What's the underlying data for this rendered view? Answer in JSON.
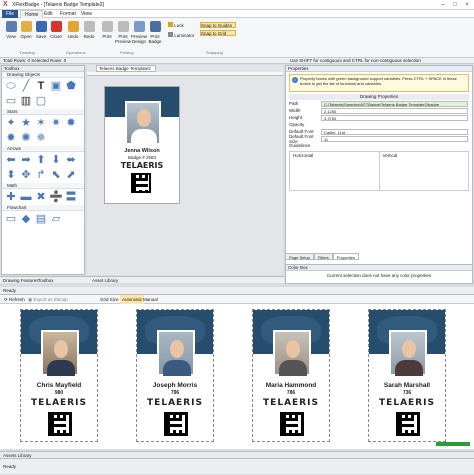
{
  "app": {
    "title": "XFlexBadge - [Telaeris Badge Template2]",
    "logo": "X"
  },
  "menu": [
    "File",
    "Home",
    "Edit",
    "Format",
    "View"
  ],
  "ribbon": {
    "buttons": [
      "View",
      "Open",
      "Save",
      "Close",
      "Undo",
      "Redo",
      "Print",
      "Print Preview",
      "Preview Design",
      "Print Badge",
      "Lock",
      "Laminator",
      "Snap to Guides",
      "Snap to Grid"
    ],
    "groups": [
      "Drawing",
      "Operations",
      "Printing",
      "Snapping"
    ]
  },
  "subbar": {
    "left": "Total Rows: 0   Selected Rows: 0",
    "right": "Use SHIFT for contiguous and CTRL for non-contiguous selection"
  },
  "toolbox": {
    "title": "Toolbox",
    "sections": [
      "Drawing Objects",
      "Stars",
      "Arrows",
      "Math",
      "Flowchart"
    ]
  },
  "document_tab": "Telaeris Badge Template2",
  "small_badge": {
    "name": "Jenna Wilson",
    "number": "Badge # 2583",
    "logo": "TELAERIS"
  },
  "properties": {
    "title": "Properties",
    "info": "Property boxes with green background support variables. Press CTRL + SPACE in these boxes to get the list of functions and variables.",
    "group": "Drawing Properties",
    "rows": [
      {
        "label": "Path",
        "value": "C:\\Telaeris\\Samples\\XFTBadge\\Telaeris Badge Template2\\badge"
      },
      {
        "label": "Width",
        "value": "2.1250"
      },
      {
        "label": "Height",
        "value": "3.3750"
      },
      {
        "label": "Opacity",
        "value": ""
      },
      {
        "label": "Default Font",
        "value": "Calibri, 11pt"
      },
      {
        "label": "Default Font Size",
        "value": "11"
      },
      {
        "label": "Guidelines",
        "value": ""
      }
    ],
    "guide_cols": [
      "Horizontal",
      "Vertical"
    ],
    "tabs": [
      "Page Setup",
      "Filters",
      "Properties"
    ]
  },
  "color_box": {
    "title": "Color Box",
    "msg": "Current selection does not have any color properties"
  },
  "bottom_tabs": [
    "Drawing Features",
    "Toolbox"
  ],
  "asset_library": "Asset Library",
  "ready": "Ready",
  "toolbar2": {
    "refresh": "Refresh",
    "export": "Export as Bitmap",
    "grid": "Grid Size",
    "auto": "Automatic",
    "manual": "Manual"
  },
  "cards": [
    {
      "name": "Chris Mayfield",
      "number": "980",
      "logo": "TELAERIS"
    },
    {
      "name": "Joseph Morris",
      "number": "796",
      "logo": "TELAERIS"
    },
    {
      "name": "Maria Hammond",
      "number": "786",
      "logo": "TELAERIS"
    },
    {
      "name": "Sarah Marshall",
      "number": "736",
      "logo": "TELAERIS"
    }
  ],
  "assets_library": "Assets Library",
  "status": "Ready"
}
